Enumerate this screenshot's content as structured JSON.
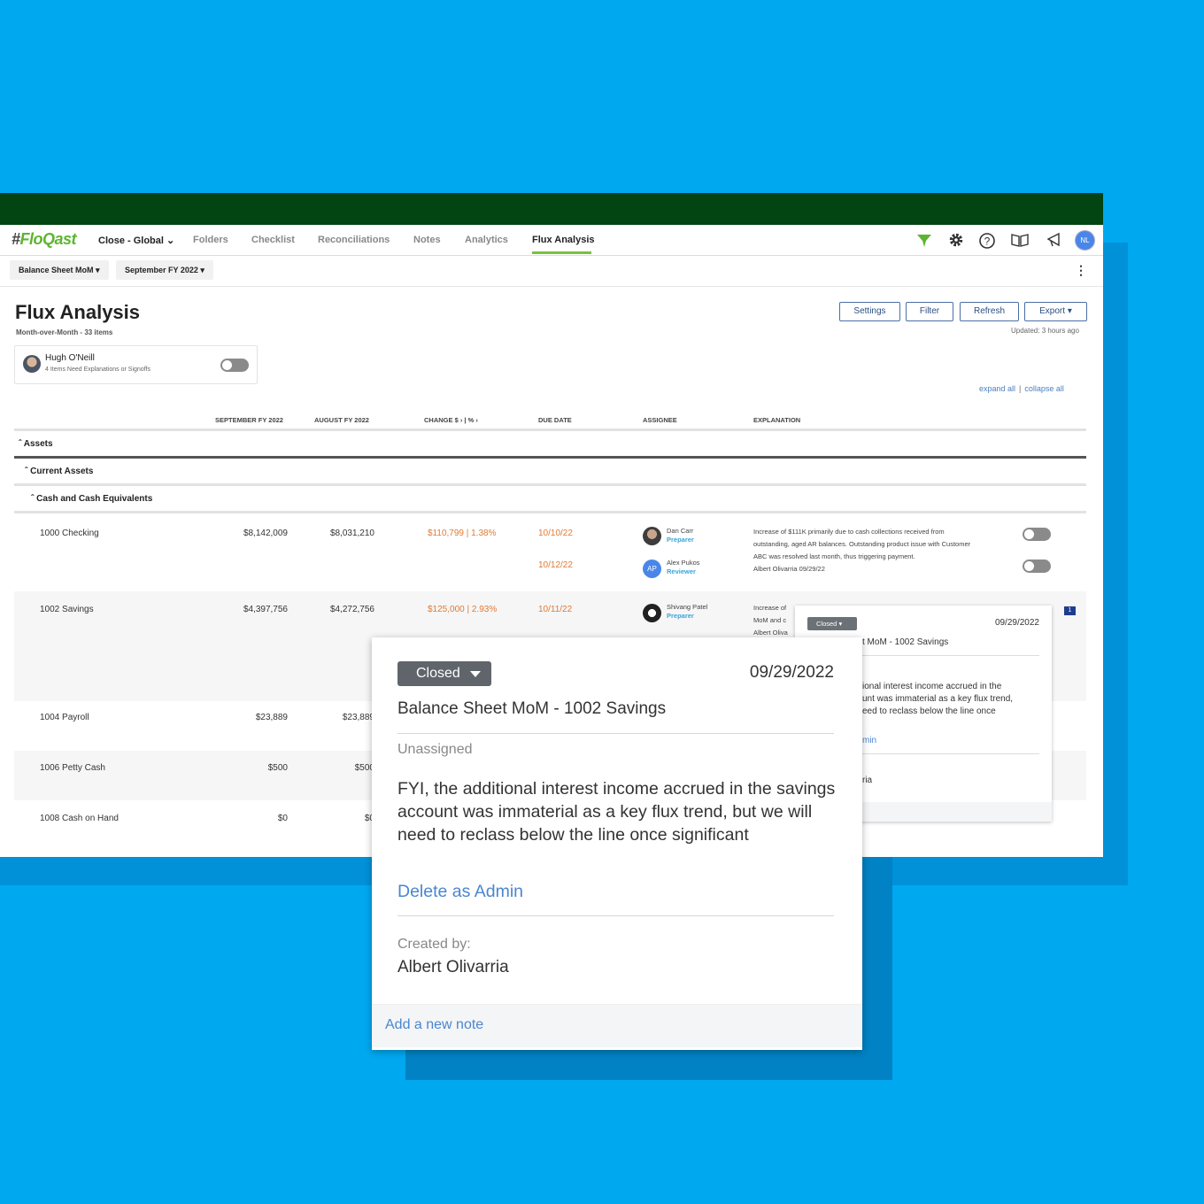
{
  "app": {
    "logo": {
      "hash": "#",
      "brand": "FloQast"
    },
    "nav": {
      "workspace": "Close - Global",
      "items": [
        "Folders",
        "Checklist",
        "Reconciliations",
        "Notes",
        "Analytics",
        "Flux Analysis"
      ],
      "active": "Flux Analysis",
      "user_initials": "NL"
    },
    "icons": [
      "flag-icon",
      "gear-icon",
      "help-icon",
      "book-icon",
      "megaphone-icon"
    ],
    "subbar": {
      "view_select": "Balance Sheet MoM",
      "period_select": "September FY 2022"
    }
  },
  "page": {
    "title": "Flux Analysis",
    "subtitle": "Month-over-Month - 33 items",
    "buttons": {
      "settings": "Settings",
      "filter": "Filter",
      "refresh": "Refresh",
      "export": "Export"
    },
    "updated": "Updated: 3 hours ago",
    "user_card": {
      "name": "Hugh O'Neill",
      "sub": "4 Items Need Explanations or Signoffs"
    },
    "links": {
      "expand": "expand all",
      "sep": "|",
      "collapse": "collapse all"
    }
  },
  "table": {
    "headers": {
      "current": "SEPTEMBER FY 2022",
      "prior": "AUGUST FY 2022",
      "change": "CHANGE $ › | % ›",
      "due": "DUE DATE",
      "assignee": "ASSIGNEE",
      "explanation": "EXPLANATION"
    },
    "sections": {
      "assets": "Assets",
      "current_assets": "Current Assets",
      "cash": "Cash and Cash Equivalents"
    },
    "rows": [
      {
        "account": "1000 Checking",
        "current": "$8,142,009",
        "prior": "$8,031,210",
        "change": "$110,799 | 1.38%",
        "due1": "10/10/22",
        "due2": "10/12/22",
        "assignee1": "Dan Carr",
        "role1": "Preparer",
        "assignee2": "Alex Pukos",
        "role2": "Reviewer",
        "initials2": "AP",
        "explanation": [
          "Increase of $111K  primarily due to cash collections received from",
          "outstanding, aged AR balances. Outstanding product issue with Customer",
          "ABC was resolved last month, thus triggering payment.",
          "Albert Olivarria 09/29/22"
        ]
      },
      {
        "account": "1002 Savings",
        "current": "$4,397,756",
        "prior": "$4,272,756",
        "change": "$125,000 | 2.93%",
        "due1": "10/11/22",
        "assignee1": "Shivang Patel",
        "role1": "Preparer",
        "explanation": [
          "Increase of",
          "MoM and c",
          "Albert Oliva"
        ],
        "note_count": "1"
      },
      {
        "account": "1004 Payroll",
        "current": "$23,889",
        "prior": "$23,889"
      },
      {
        "account": "1006 Petty Cash",
        "current": "$500",
        "prior": "$500"
      },
      {
        "account": "1008 Cash on Hand",
        "current": "$0",
        "prior": "$0"
      }
    ]
  },
  "note_small": {
    "status": "Closed",
    "date": "09/29/2022",
    "title": "t MoM - 1002 Savings",
    "body": [
      "ional interest income accrued in the",
      "unt was immaterial as a key flux trend,",
      "eed to reclass below the line once"
    ],
    "link": "min",
    "name": "ria"
  },
  "note_popup": {
    "status": "Closed",
    "date": "09/29/2022",
    "title": "Balance Sheet MoM - 1002 Savings",
    "assignee": "Unassigned",
    "body": "FYI, the additional interest income accrued in the savings account was immaterial as a key flux trend, but we will need to reclass below the line once significant",
    "delete_link": "Delete as Admin",
    "created_label": "Created by:",
    "created_by": "Albert Olivarria",
    "footer_link": "Add a new note"
  },
  "colors": {
    "accent_green": "#7ac142",
    "header_green": "#024513",
    "change_orange": "#e07a35",
    "link_blue": "#4a86d0",
    "background": "#00a8f0"
  }
}
